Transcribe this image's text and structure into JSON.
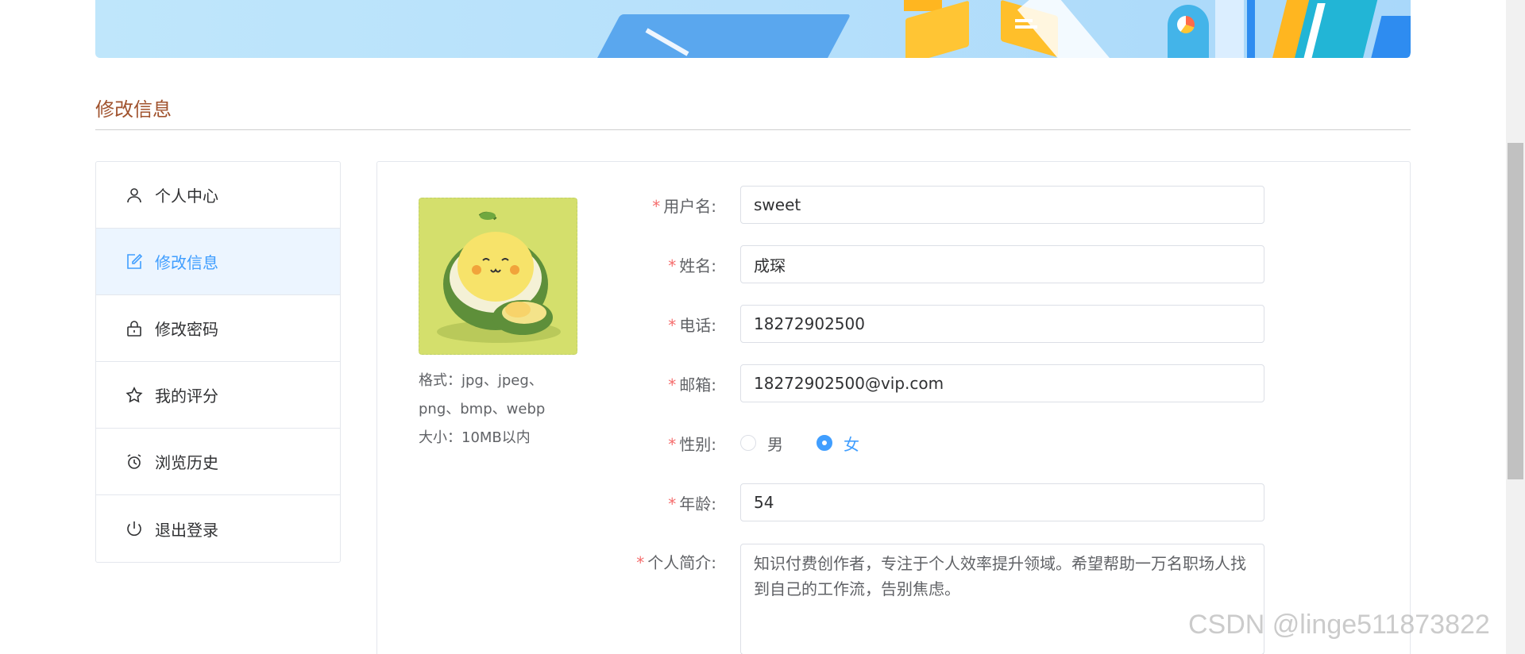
{
  "section": {
    "title": "修改信息"
  },
  "menu": {
    "items": [
      {
        "label": "个人中心",
        "icon": "user-icon",
        "active": false
      },
      {
        "label": "修改信息",
        "icon": "edit-icon",
        "active": true
      },
      {
        "label": "修改密码",
        "icon": "lock-icon",
        "active": false
      },
      {
        "label": "我的评分",
        "icon": "star-icon",
        "active": false
      },
      {
        "label": "浏览历史",
        "icon": "alarm-clock-icon",
        "active": false
      },
      {
        "label": "退出登录",
        "icon": "power-icon",
        "active": false
      }
    ]
  },
  "avatar": {
    "hint_line1": "格式：jpg、jpeg、",
    "hint_line2": "png、bmp、webp",
    "hint_line3": "大小：10MB以内"
  },
  "form": {
    "username": {
      "label": "用户名:",
      "value": "sweet"
    },
    "name": {
      "label": "姓名:",
      "value": "成琛"
    },
    "phone": {
      "label": "电话:",
      "value": "18272902500"
    },
    "email": {
      "label": "邮箱:",
      "value": "18272902500@vip.com"
    },
    "gender": {
      "label": "性别:",
      "options": [
        "男",
        "女"
      ],
      "selected": "女"
    },
    "age": {
      "label": "年龄:",
      "value": "54"
    },
    "bio": {
      "label": "个人简介:",
      "value": "知识付费创作者，专注于个人效率提升领域。希望帮助一万名职场人找到自己的工作流，告别焦虑。"
    }
  },
  "watermark": "CSDN @linge511873822",
  "colors": {
    "accent": "#409eff",
    "required": "#f56c6c",
    "title": "#a0522d",
    "active_bg": "#ecf5ff"
  }
}
